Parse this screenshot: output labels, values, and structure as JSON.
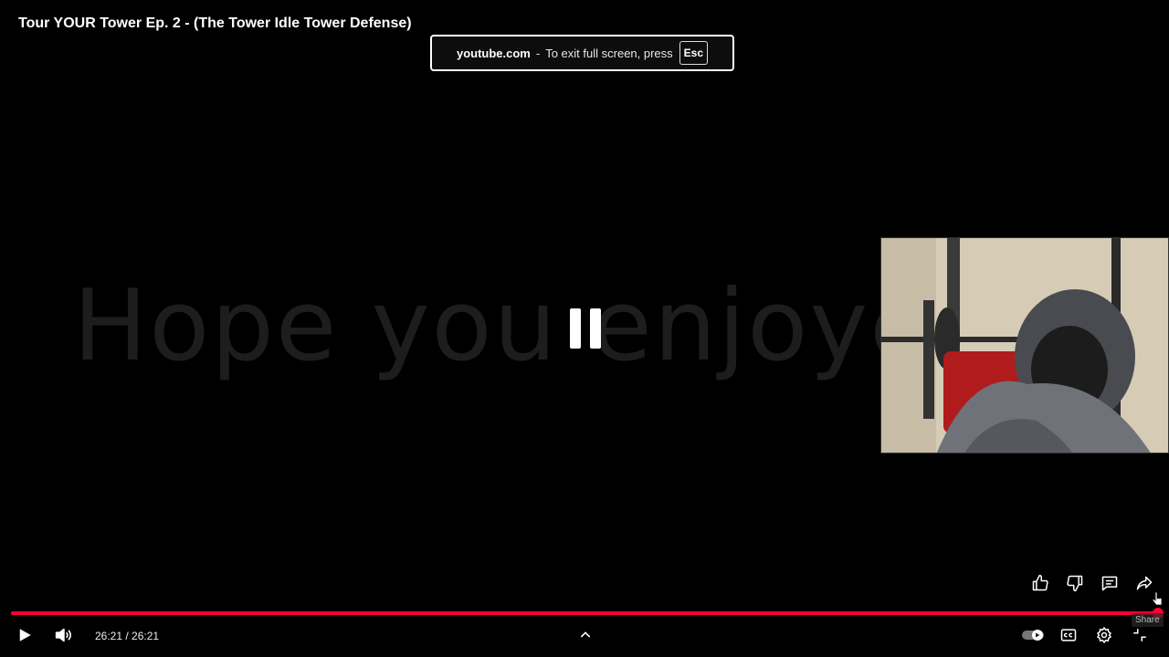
{
  "video": {
    "title": "Tour YOUR Tower Ep. 2 - (The Tower Idle Tower Defense)",
    "overlay_text": "Hope you enjoye"
  },
  "fullscreen_notice": {
    "domain": "youtube.com",
    "separator": "-",
    "message": "To exit full screen, press",
    "key": "Esc"
  },
  "actions": {
    "like_icon": "thumbs-up-icon",
    "dislike_icon": "thumbs-down-icon",
    "comments_icon": "comments-icon",
    "share_icon": "share-icon",
    "share_tooltip": "Share"
  },
  "player": {
    "time": "26:21 / 26:21",
    "progress": 1.0,
    "accent_color": "#ff0033"
  }
}
